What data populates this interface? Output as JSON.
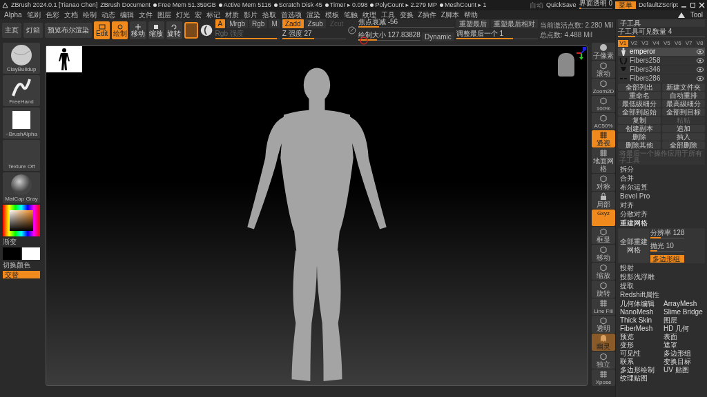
{
  "title_bar": {
    "app": "ZBrush 2024.0.1 [Tianao Chen]",
    "document": "ZBrush Document",
    "stats": [
      "Free Mem 51.359GB",
      "Active Mem 5116",
      "Scratch Disk 45",
      "Timer ▸ 0.098",
      "PolyCount ▸ 2.279 MP",
      "MeshCount ▸ 1"
    ],
    "auto": "自动",
    "quicksave": "QuickSave",
    "opacity": {
      "label": "界面透明 0",
      "level": 0.06
    },
    "menu_button": {
      "label": "菜单",
      "selected": true
    },
    "script": "DefaultZScript"
  },
  "menu_bar": [
    "Alpha",
    "笔刷",
    "色彩",
    "文档",
    "绘制",
    "动态",
    "编辑",
    "文件",
    "图层",
    "灯光",
    "宏",
    "标记",
    "材质",
    "影片",
    "拾取",
    "首选项",
    "渲染",
    "模板",
    "笔触",
    "纹理",
    "工具",
    "变换",
    "Z插件",
    "Z脚本",
    "帮助"
  ],
  "tool_thumb": {
    "label": "Tool"
  },
  "toolbar": {
    "buttons": [
      "主页",
      "灯箱",
      "预览布尔渲染"
    ],
    "modes": [
      {
        "label": "Edit",
        "selected": true
      },
      {
        "label": "绘制",
        "selected": true
      },
      {
        "label": "移动",
        "selected": false
      },
      {
        "label": "缩放",
        "selected": false
      },
      {
        "label": "旋转",
        "selected": false
      }
    ],
    "channels": [
      {
        "label": "A",
        "selected": true
      },
      {
        "label": "Mrgb",
        "selected": false
      },
      {
        "label": "Rgb",
        "selected": false
      },
      {
        "label": "M",
        "selected": false
      }
    ],
    "rgb_intensity": {
      "label": "Rgb 强度",
      "level": 0.95
    },
    "z_modes": [
      {
        "label": "Zadd",
        "selected": true,
        "disabled": false
      },
      {
        "label": "Zsub",
        "selected": false,
        "disabled": false
      },
      {
        "label": "Zcut",
        "selected": false,
        "disabled": true
      }
    ],
    "z_intensity": {
      "label": "Z 强度 27",
      "level": 0.5
    },
    "focal": {
      "label": "焦点衰减 -56",
      "level": 0.22
    },
    "draw_size": {
      "label": "绘制大小 127.83828",
      "level": 0.3
    },
    "dynamic": "Dynamic",
    "remesh_buttons": [
      "重塑最后",
      "重塑最后相对"
    ],
    "adjust_last": {
      "label": "调整最后一个 1",
      "level": 0.7
    },
    "info": [
      "当前激活点数: 2.280 Mil",
      "总点数: 4.488 Mil"
    ]
  },
  "left_tools": {
    "tiles": [
      {
        "label": "ClayBuildup",
        "kind": "brush"
      },
      {
        "label": "FreeHand",
        "kind": "stroke"
      },
      {
        "label": "~BrushAlpha",
        "kind": "alpha"
      },
      {
        "label": "Texture Off",
        "kind": "texture"
      },
      {
        "label": "MatCap Gray",
        "kind": "material"
      }
    ],
    "gradient": "渐变",
    "switch_color": "切换颜色",
    "alternate": {
      "label": "交替",
      "selected": true
    }
  },
  "shelf": [
    {
      "label": "子像素",
      "kind": "sphere",
      "selected": false
    },
    {
      "label": "滚动",
      "kind": "cube",
      "selected": false
    },
    {
      "label": "Zoom2D",
      "kind": "cube",
      "selected": false
    },
    {
      "label": "100%",
      "kind": "cube",
      "selected": false
    },
    {
      "label": "AC50%",
      "kind": "cube",
      "selected": false
    },
    {
      "label": "透视",
      "kind": "grid",
      "selected": true
    },
    {
      "label": "地面网格",
      "kind": "grid",
      "selected": false
    },
    {
      "label": "对称",
      "kind": "cube",
      "selected": false
    },
    {
      "label": "局部",
      "kind": "lock",
      "selected": false
    },
    {
      "label": "Gxyz",
      "kind": "text",
      "selected": true
    },
    {
      "label": "框显",
      "kind": "cube",
      "selected": false
    },
    {
      "label": "移动",
      "kind": "cube",
      "selected": false
    },
    {
      "label": "缩放",
      "kind": "cube",
      "selected": false
    },
    {
      "label": "旋转",
      "kind": "cube",
      "selected": false
    },
    {
      "label": "Line Fill",
      "kind": "grid",
      "selected": false
    },
    {
      "label": "透明",
      "kind": "cube",
      "selected": false
    },
    {
      "label": "幽灵",
      "kind": "ghost",
      "selected": true
    },
    {
      "label": "独立",
      "kind": "cube",
      "selected": false
    },
    {
      "label": "Xpose",
      "kind": "grid",
      "selected": false
    }
  ],
  "subtool": {
    "title": "子工具",
    "visible_count": {
      "label": "子工具可见数量 4",
      "level": 0.2
    },
    "versions": [
      {
        "label": "V1",
        "selected": true
      },
      {
        "label": "V2",
        "selected": false
      },
      {
        "label": "V3",
        "selected": false
      },
      {
        "label": "V4",
        "selected": false
      },
      {
        "label": "V5",
        "selected": false
      },
      {
        "label": "V6",
        "selected": false
      },
      {
        "label": "V7",
        "selected": false
      },
      {
        "label": "V8",
        "selected": false
      }
    ],
    "items": [
      {
        "name": "emperor",
        "kind": "body",
        "selected": true
      },
      {
        "name": "Fibers258",
        "kind": "horns",
        "selected": false
      },
      {
        "name": "Fibers346",
        "kind": "beard",
        "selected": false
      },
      {
        "name": "Fibers286",
        "kind": "brows",
        "selected": false
      }
    ],
    "button_rows": [
      [
        {
          "label": "全部列出",
          "disabled": false
        },
        {
          "label": "新建文件夹",
          "disabled": false
        }
      ],
      [
        {
          "label": "重命名",
          "disabled": false
        },
        {
          "label": "自动重排",
          "disabled": false
        }
      ],
      [
        {
          "label": "最低级细分",
          "disabled": false
        },
        {
          "label": "最高级细分",
          "disabled": false
        }
      ],
      [
        {
          "label": "全部到起始",
          "disabled": false
        },
        {
          "label": "全部到目标",
          "disabled": false
        }
      ],
      [
        {
          "label": "复制",
          "disabled": false
        },
        {
          "label": "粘贴",
          "disabled": true
        }
      ],
      [
        {
          "label": "创建副本",
          "disabled": false
        },
        {
          "label": "追加",
          "disabled": false
        }
      ],
      [
        {
          "label": "删除",
          "disabled": false
        },
        {
          "label": "插入",
          "disabled": false
        }
      ],
      [
        {
          "label": "删除其他",
          "disabled": false
        },
        {
          "label": "全部删除",
          "disabled": false
        }
      ]
    ],
    "note": "将最后一个操作应用于所有子工具",
    "actions": [
      "拆分",
      "合并",
      "布尔运算",
      "Bevel Pro",
      "对齐",
      "分散对齐"
    ],
    "remesh": {
      "label": "重建网格",
      "expanded": true
    },
    "remesh_all": "全部重建网格",
    "resolution": {
      "label": "分辨率 128",
      "level": 0.3
    },
    "polish": {
      "label": "抛光 10",
      "level": 0.2
    },
    "polygroups": {
      "label": "多边形组",
      "selected": true
    },
    "more": [
      "投射",
      "投影浅浮雕",
      "提取",
      "Redshift属性"
    ]
  },
  "tool_menu": [
    "几何体编辑",
    "ArrayMesh",
    "NanoMesh",
    "Slime Bridge",
    "Thick Skin",
    "图层",
    "FiberMesh",
    "HD 几何",
    "预览",
    "表面",
    "变形",
    "遮罩",
    "可见性",
    "多边形组",
    "联系",
    "变换目标",
    "多边形绘制",
    "UV 贴图",
    "纹理贴图"
  ]
}
